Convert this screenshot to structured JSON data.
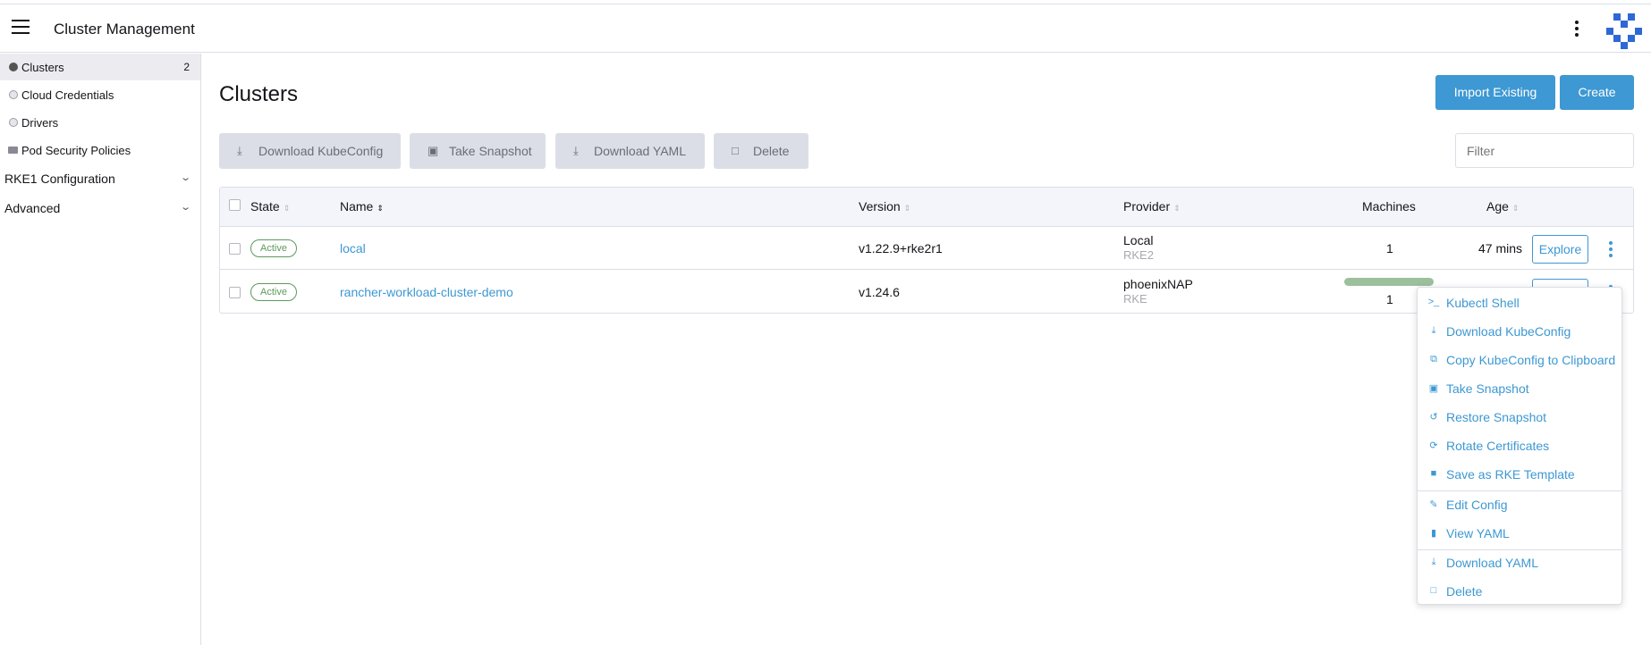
{
  "header": {
    "title": "Cluster Management"
  },
  "sidebar": {
    "items": [
      {
        "label": "Clusters",
        "count": "2"
      },
      {
        "label": "Cloud Credentials"
      },
      {
        "label": "Drivers"
      },
      {
        "label": "Pod Security Policies"
      }
    ],
    "groups": [
      {
        "label": "RKE1 Configuration",
        "icon": "chevron-down-icon"
      },
      {
        "label": "Advanced",
        "icon": "chevron-down-icon"
      }
    ]
  },
  "page": {
    "title": "Clusters",
    "import_label": "Import Existing",
    "create_label": "Create",
    "filter_placeholder": "Filter"
  },
  "bulk_actions": [
    {
      "label": "Download KubeConfig",
      "icon": "download-icon"
    },
    {
      "label": "Take Snapshot",
      "icon": "camera-icon"
    },
    {
      "label": "Download YAML",
      "icon": "download-icon"
    },
    {
      "label": "Delete",
      "icon": "trash-icon"
    }
  ],
  "table": {
    "columns": [
      "State",
      "Name",
      "Version",
      "Provider",
      "Machines",
      "Age"
    ],
    "rows": [
      {
        "state": "Active",
        "name": "local",
        "version": "v1.22.9+rke2r1",
        "provider": "Local",
        "provider_sub": "RKE2",
        "machines": "1",
        "age": "47 mins",
        "action": "Explore"
      },
      {
        "state": "Active",
        "name": "rancher-workload-cluster-demo",
        "version": "v1.24.6",
        "provider": "phoenixNAP",
        "provider_sub": "RKE",
        "machines": "1",
        "machines_progress": 1.0,
        "age": "",
        "action": "Explore"
      }
    ]
  },
  "context_menu": {
    "items": [
      {
        "label": "Kubectl Shell",
        "icon": "terminal-icon"
      },
      {
        "label": "Download KubeConfig",
        "icon": "download-icon"
      },
      {
        "label": "Copy KubeConfig to Clipboard",
        "icon": "copy-icon"
      },
      {
        "label": "Take Snapshot",
        "icon": "camera-icon"
      },
      {
        "label": "Restore Snapshot",
        "icon": "history-icon"
      },
      {
        "label": "Rotate Certificates",
        "icon": "refresh-icon"
      },
      {
        "label": "Save as RKE Template",
        "icon": "folder-icon"
      },
      {
        "label": "Edit Config",
        "icon": "pencil-icon"
      },
      {
        "label": "View YAML",
        "icon": "file-icon"
      },
      {
        "label": "Download YAML",
        "icon": "download-icon"
      },
      {
        "label": "Delete",
        "icon": "trash-icon"
      }
    ]
  },
  "colors": {
    "accent": "#3d98d3",
    "active": "#5d995d",
    "disabled_button": "#dcdee7"
  }
}
